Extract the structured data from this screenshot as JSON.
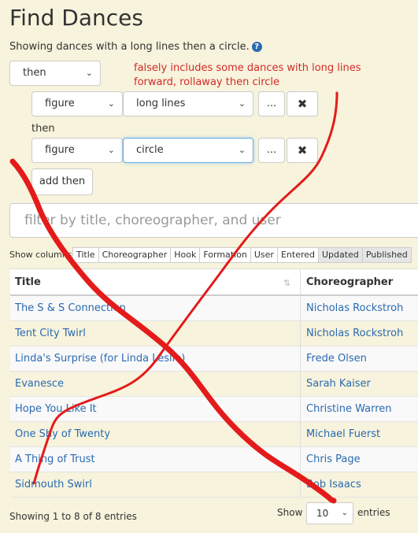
{
  "page": {
    "title": "Find Dances",
    "subtitle": "Showing dances with a long lines then a circle."
  },
  "icons": {
    "help": "question-circle-icon",
    "remove": "x-icon",
    "dropdown": "chevron-down-icon",
    "sort": "sort-icon"
  },
  "filter": {
    "top_select": "then",
    "rows": [
      {
        "kind": "figure",
        "figure": "long lines",
        "more": "...",
        "remove": "✖"
      },
      {
        "kind": "figure",
        "figure": "circle",
        "more": "...",
        "remove": "✖"
      }
    ],
    "then_label": "then",
    "add_then": "add then"
  },
  "annotation": {
    "note": "falsely includes some dances with long lines forward, rollaway then circle",
    "color": "#d42a2a"
  },
  "search": {
    "placeholder": "filter by title, choreographer, and user"
  },
  "columns": {
    "label": "Show columns",
    "buttons": [
      "Title",
      "Choreographer",
      "Hook",
      "Formation",
      "User",
      "Entered",
      "Updated",
      "Published"
    ]
  },
  "table": {
    "headers": [
      "Title",
      "Choreographer"
    ],
    "rows": [
      [
        "The S & S Connection",
        "Nicholas Rockstroh"
      ],
      [
        "Tent City Twirl",
        "Nicholas Rockstroh"
      ],
      [
        "Linda's Surprise (for Linda Leslie)",
        "Frede Olsen"
      ],
      [
        "Evanesce",
        "Sarah Kaiser"
      ],
      [
        "Hope You Like It",
        "Christine Warren"
      ],
      [
        "One Shy of Twenty",
        "Michael Fuerst"
      ],
      [
        "A Thing of Trust",
        "Chris Page"
      ],
      [
        "Sidmouth Swirl",
        "Bob Isaacs"
      ]
    ]
  },
  "footer": {
    "info": "Showing 1 to 8 of 8 entries",
    "show": "Show",
    "page_size": "10",
    "entries": "entries"
  },
  "colors": {
    "background": "#f7f3dc",
    "link": "#2a6ab2",
    "scribble": "#e41b1b"
  }
}
